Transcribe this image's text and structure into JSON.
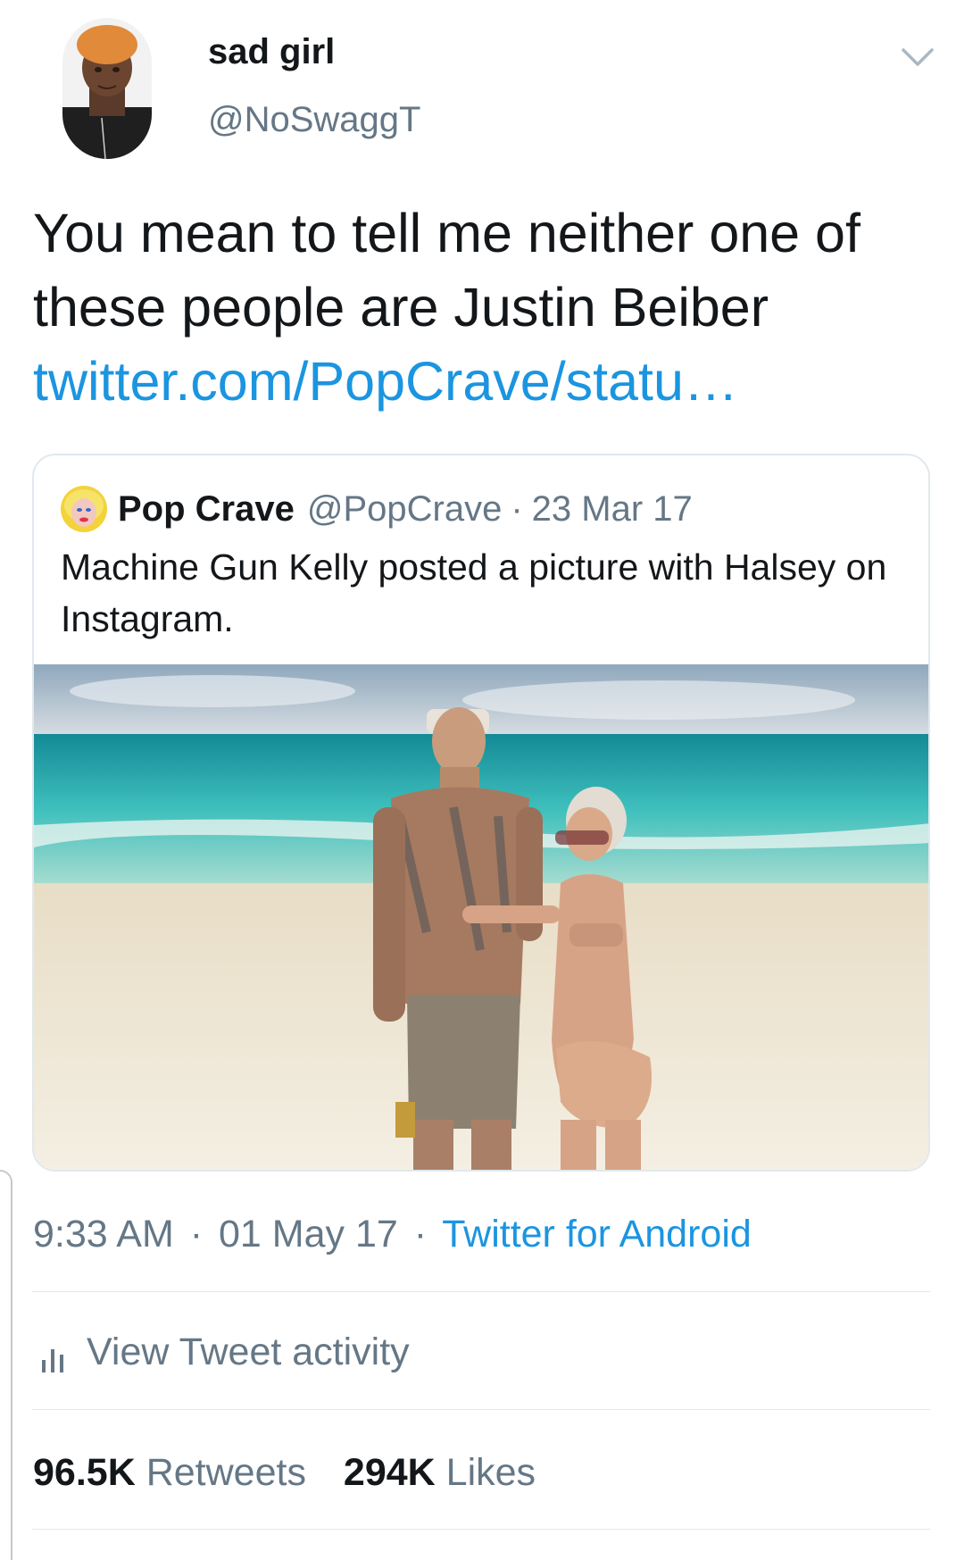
{
  "tweet": {
    "author": {
      "display_name": "sad girl",
      "handle": "@NoSwaggT"
    },
    "text_line": "You mean to tell me neither one of these people are Justin Beiber ",
    "link_text": "twitter.com/PopCrave/statu…",
    "quoted_tweet": {
      "display_name": "Pop Crave",
      "handle": "@PopCrave",
      "separator": "·",
      "date": "23 Mar 17",
      "text": "Machine Gun Kelly posted a picture with Halsey on Instagram."
    },
    "meta": {
      "time": "9:33 AM",
      "sep1": "·",
      "date": "01 May 17",
      "sep2": "·",
      "source": "Twitter for Android"
    },
    "activity_label": "View Tweet activity",
    "stats": {
      "retweets_count": "96.5K",
      "retweets_label": "Retweets",
      "likes_count": "294K",
      "likes_label": "Likes"
    }
  },
  "colors": {
    "text": "#14171a",
    "secondary": "#657786",
    "link": "#1b95e0",
    "border": "#e1e8ed"
  },
  "icons": {
    "menu": "chevron-down-icon",
    "activity": "bar-chart-icon"
  }
}
